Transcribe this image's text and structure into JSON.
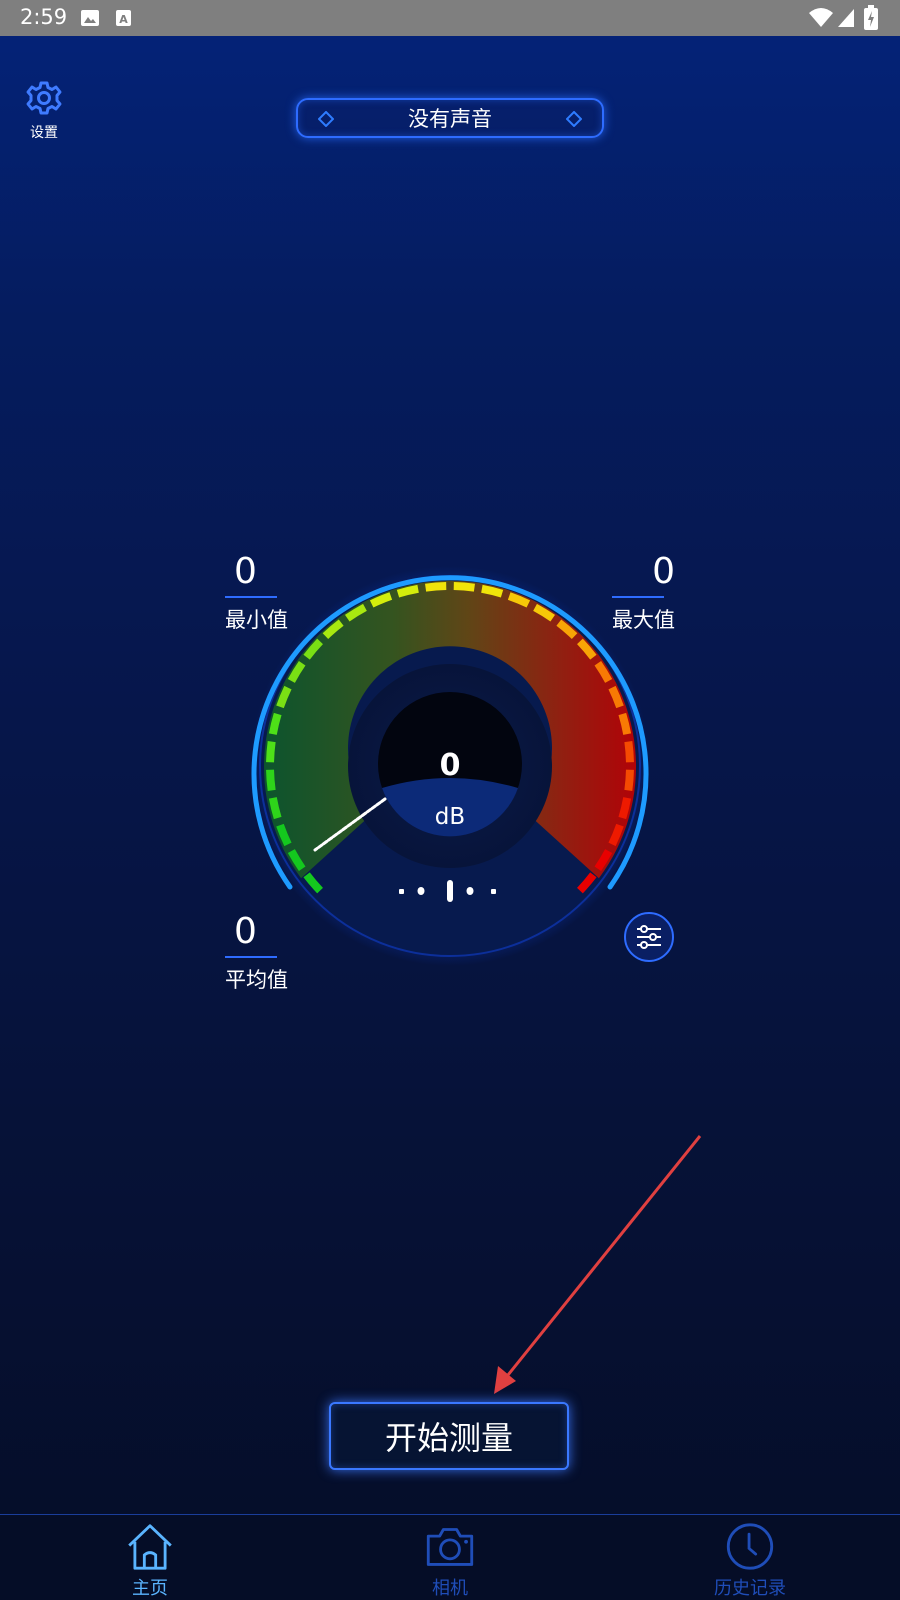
{
  "status_bar": {
    "time": "2:59",
    "icons": [
      "image-icon",
      "a-icon",
      "wifi-icon",
      "signal-icon",
      "battery-icon"
    ]
  },
  "settings": {
    "label": "设置",
    "icon": "gear-icon"
  },
  "sound_status": {
    "text": "没有声音"
  },
  "stats": {
    "min": {
      "value": "0",
      "label": "最小值"
    },
    "max": {
      "value": "0",
      "label": "最大值"
    },
    "avg": {
      "value": "0",
      "label": "平均值"
    }
  },
  "gauge": {
    "value": "0",
    "unit": "dB"
  },
  "start_button": {
    "label": "开始测量"
  },
  "nav": {
    "items": [
      {
        "label": "主页",
        "icon": "home-icon",
        "active": true
      },
      {
        "label": "相机",
        "icon": "camera-icon",
        "active": false
      },
      {
        "label": "历史记录",
        "icon": "clock-icon",
        "active": false
      }
    ]
  },
  "colors": {
    "accent": "#2e6cff",
    "active_nav": "#5ab4ff",
    "inactive_nav": "#1f4db8",
    "annotation": "#e04040"
  }
}
